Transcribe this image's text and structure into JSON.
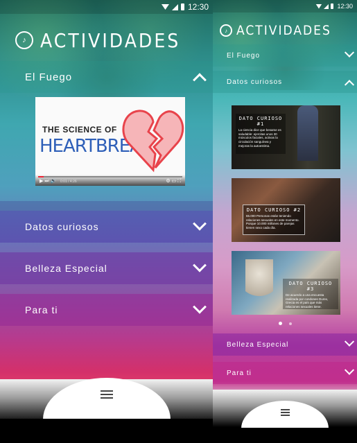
{
  "status": {
    "time": "12:30"
  },
  "left": {
    "header": {
      "title": "ACTIVIDADES"
    },
    "sections": [
      {
        "label": "El Fuego",
        "expanded": true
      },
      {
        "label": "Datos curiosos",
        "expanded": false
      },
      {
        "label": "Belleza Especial",
        "expanded": false
      },
      {
        "label": "Para ti",
        "expanded": false
      }
    ],
    "video": {
      "line1": "THE SCIENCE OF",
      "line2": "HEARTBREAK",
      "time": "0:01 / 4:26"
    }
  },
  "right": {
    "header": {
      "title": "ACTIVIDADES"
    },
    "sections": [
      {
        "label": "El Fuego",
        "expanded": false
      },
      {
        "label": "Datos curiosos",
        "expanded": true
      },
      {
        "label": "Belleza Especial",
        "expanded": false
      },
      {
        "label": "Para ti",
        "expanded": false
      }
    ],
    "cards": [
      {
        "title": "DATO CURIOSO #1",
        "text": "La ciencia dice que besarse es saludable: ejercitas unos 30 músculos faciales, activas la circulación sanguínea y mejoras la autoestima."
      },
      {
        "title": "DATO CURIOSO #2",
        "text": "65.000 Personas están teniendo relaciones sexuales en este momento. Porque 10.000 millones de parejas tienen sexo cada día."
      },
      {
        "title": "DATO CURIOSO #3",
        "text": "De acuerdo a una encuesta realizada por condones Durex, Grecia es el país que más relaciones sexuales tiene."
      }
    ],
    "pager": {
      "count": 2,
      "active": 0
    }
  },
  "colors": {
    "accent_white": "#ffffff",
    "heart_red": "#e8434b",
    "heartbreak_blue": "#2e5fb8"
  }
}
